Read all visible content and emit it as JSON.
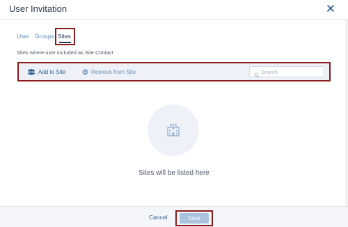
{
  "dialog": {
    "title": "User Invitation"
  },
  "tabs": [
    {
      "label": "User"
    },
    {
      "label": "Groups"
    },
    {
      "label": "Sites",
      "active": true
    }
  ],
  "subtitle": "Sites where user included as Site Contact",
  "toolbar": {
    "add_label": "Add to Site",
    "remove_label": "Remove from Site",
    "search_placeholder": "Search",
    "search_value": ""
  },
  "empty_state": {
    "message": "Sites will be listed here",
    "icon": "hospital-building-icon"
  },
  "footer": {
    "cancel_label": "Cancel",
    "save_label": "Save"
  },
  "colors": {
    "primary": "#2d5f92",
    "link": "#5a86b6",
    "toolbar_bg": "#eef2f8",
    "save_disabled": "#a9c2de",
    "highlight_outline": "#8b1a1a"
  },
  "icons": {
    "close": "close-icon",
    "add": "users-add-icon",
    "remove": "minus-circle-icon",
    "search": "search-icon"
  }
}
